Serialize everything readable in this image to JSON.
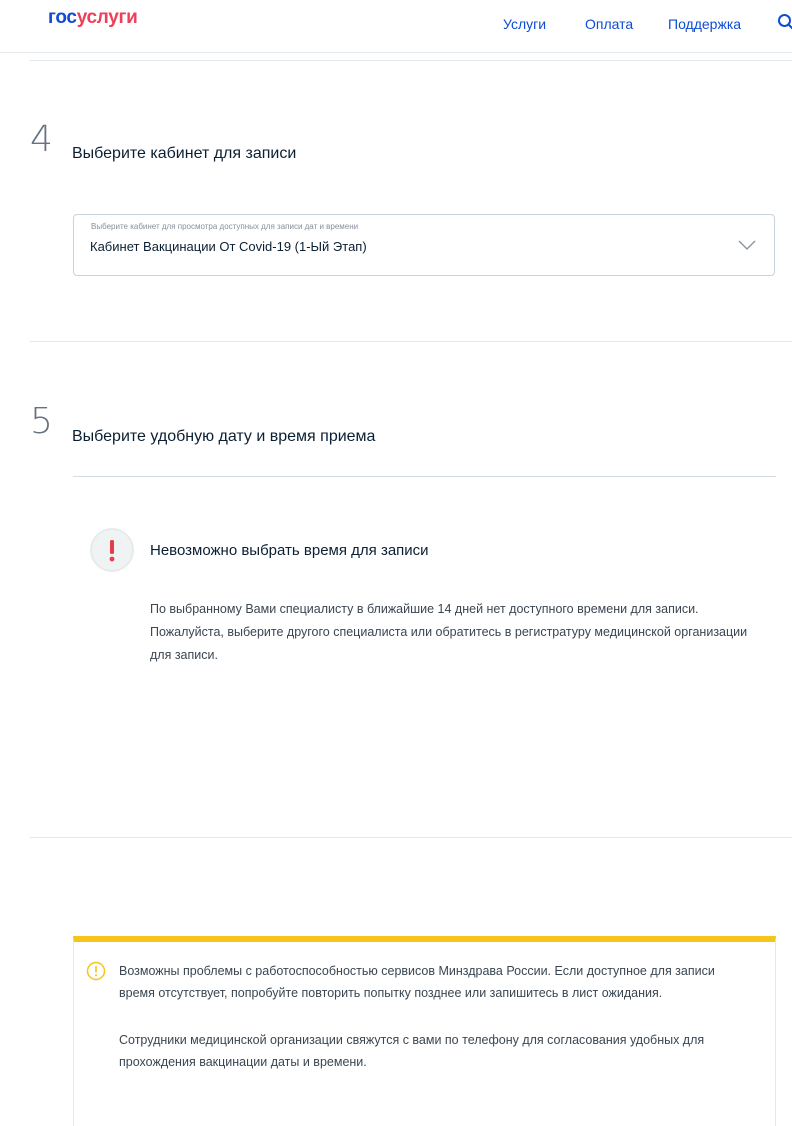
{
  "header": {
    "logo_part1": "гос",
    "logo_part2": "услуги",
    "nav": {
      "services": "Услуги",
      "payment": "Оплата",
      "support": "Поддержка"
    }
  },
  "step4": {
    "number": "4",
    "title": "Выберите кабинет для записи",
    "select": {
      "label": "Выберите кабинет для просмотра доступных для записи дат и времени",
      "value": "Кабинет Вакцинации От Covid-19 (1-Ый Этап)"
    }
  },
  "step5": {
    "number": "5",
    "title": "Выберите удобную дату и время приема",
    "error": {
      "title": "Невозможно выбрать время для записи",
      "text": "По выбранному Вами специалисту в ближайшие 14 дней нет доступного времени для записи. Пожалуйста, выберите другого специалиста или обратитесь в регистратуру медицинской организации для записи."
    }
  },
  "notice": {
    "paragraph1": "Возможны проблемы с работоспособностью сервисов Минздрава России. Если доступное для записи время отсутствует, попробуйте повторить попытку позднее или запишитесь в лист ожидания.",
    "paragraph2": "Сотрудники медицинской организации свяжутся с вами по телефону для согласования удобных для прохождения вакцинации даты и времени."
  },
  "colors": {
    "brand_blue": "#0d4cd3",
    "brand_red": "#ee3f58",
    "warning_yellow": "#f7c41b",
    "error_red": "#e63c4e"
  }
}
